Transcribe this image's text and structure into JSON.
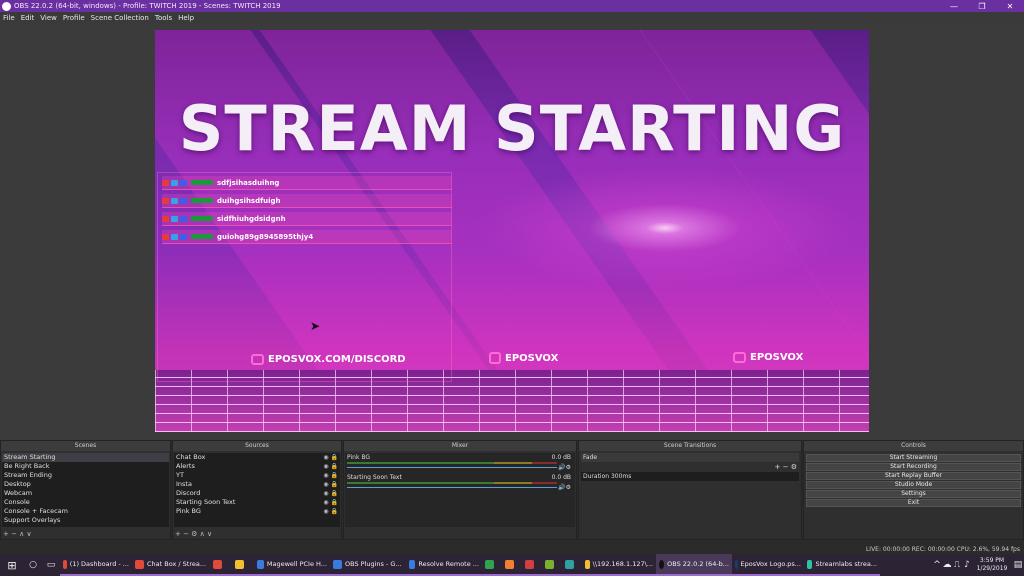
{
  "window": {
    "title": "OBS 22.0.2 (64-bit, windows) - Profile: TWITCH 2019 - Scenes: TWITCH 2019",
    "controls": [
      "—",
      "❐",
      "✕"
    ]
  },
  "menu": [
    "File",
    "Edit",
    "View",
    "Profile",
    "Scene Collection",
    "Tools",
    "Help"
  ],
  "preview": {
    "headline": "STREAM STARTING",
    "chat": [
      {
        "text": "sdfjsihasduihng"
      },
      {
        "text": "duihgsihsdfuigh"
      },
      {
        "text": "sidfhiuhgdsidgnh"
      },
      {
        "text": "guiohg89g8945895thjy4"
      }
    ],
    "social": [
      {
        "label": "EPOSVOX.COM/DISCORD",
        "icon": "discord-icon"
      },
      {
        "label": "EPOSVOX",
        "icon": "instagram-icon"
      },
      {
        "label": "EPOSVOX",
        "icon": "youtube-icon"
      }
    ]
  },
  "docks": {
    "scenes": {
      "title": "Scenes",
      "items": [
        "Stream Starting",
        "Be Right Back",
        "Stream Ending",
        "Desktop",
        "Webcam",
        "Console",
        "Console + Facecam",
        "Support Overlays"
      ],
      "footer": "+ − ∧ ∨"
    },
    "sources": {
      "title": "Sources",
      "items": [
        "Chat Box",
        "Alerts",
        "YT",
        "Insta",
        "Discord",
        "Starting Soon Text",
        "Pink BG"
      ],
      "footer": "+ − ⚙ ∧ ∨"
    },
    "mixer": {
      "title": "Mixer",
      "tracks": [
        {
          "name": "Pink BG",
          "db": "0.0 dB"
        },
        {
          "name": "Starting Soon Text",
          "db": "0.0 dB"
        }
      ]
    },
    "transitions": {
      "title": "Scene Transitions",
      "selected": "Fade",
      "add_remove": "+ − ⚙",
      "duration": "Duration 300ms"
    },
    "controls": {
      "title": "Controls",
      "buttons": [
        "Start Streaming",
        "Start Recording",
        "Start Replay Buffer",
        "Studio Mode",
        "Settings",
        "Exit"
      ]
    }
  },
  "statusbar": {
    "text": "LIVE: 00:00:00    REC: 00:00:00    CPU: 2.6%, 59.94 fps"
  },
  "taskbar": {
    "apps": [
      {
        "label": "(1) Dashboard - ...",
        "color": "#e04a3a"
      },
      {
        "label": "Chat Box / Strea...",
        "color": "#e04a3a"
      },
      {
        "label": "",
        "color": "#e04a3a"
      },
      {
        "label": "",
        "color": "#f0c030"
      },
      {
        "label": "Magewell PCIe H...",
        "color": "#3a7be0"
      },
      {
        "label": "OBS Plugins - G...",
        "color": "#3a7be0"
      },
      {
        "label": "Resolve Remote ...",
        "color": "#3a7be0"
      },
      {
        "label": "",
        "color": "#2ea44f"
      },
      {
        "label": "",
        "color": "#f08030"
      },
      {
        "label": "",
        "color": "#d04040"
      },
      {
        "label": "",
        "color": "#7ab030"
      },
      {
        "label": "",
        "color": "#30a0a0"
      },
      {
        "label": "\\\\192.168.1.127\\...",
        "color": "#f0c030"
      },
      {
        "label": "OBS 22.0.2 (64-b...",
        "color": "#333333",
        "active": true
      },
      {
        "label": "EposVox Logo.ps...",
        "color": "#1e3a6a"
      },
      {
        "label": "Streamlabs strea...",
        "color": "#2ec4a0"
      }
    ],
    "time": "3:59 PM",
    "date": "1/29/2019"
  }
}
